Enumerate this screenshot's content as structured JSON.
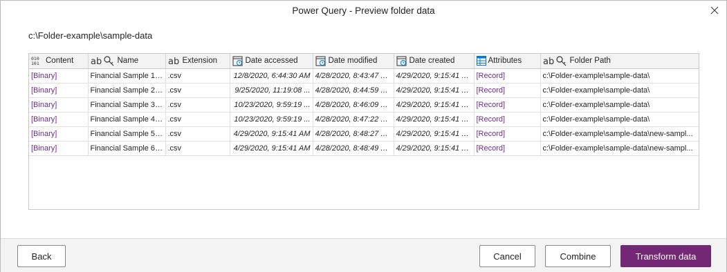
{
  "window": {
    "title": "Power Query - Preview folder data"
  },
  "folder_path": "c:\\Folder-example\\sample-data",
  "table": {
    "columns": [
      {
        "label": "Content",
        "type_icon": "binary-type-icon"
      },
      {
        "label": "Name",
        "type_icon": "text-key-type-icon"
      },
      {
        "label": "Extension",
        "type_icon": "text-type-icon"
      },
      {
        "label": "Date accessed",
        "type_icon": "datetime-type-icon"
      },
      {
        "label": "Date modified",
        "type_icon": "datetime-type-icon"
      },
      {
        "label": "Date created",
        "type_icon": "datetime-type-icon"
      },
      {
        "label": "Attributes",
        "type_icon": "record-type-icon"
      },
      {
        "label": "Folder Path",
        "type_icon": "text-key-type-icon"
      }
    ],
    "rows": [
      [
        "[Binary]",
        "Financial Sample 1....",
        ".csv",
        "12/8/2020, 6:44:30 AM",
        "4/28/2020, 8:43:47 AM",
        "4/29/2020, 9:15:41 A...",
        "[Record]",
        "c:\\Folder-example\\sample-data\\"
      ],
      [
        "[Binary]",
        "Financial Sample 2....",
        ".csv",
        "9/25/2020, 11:19:08 ...",
        "4/28/2020, 8:44:59 AM",
        "4/29/2020, 9:15:41 A...",
        "[Record]",
        "c:\\Folder-example\\sample-data\\"
      ],
      [
        "[Binary]",
        "Financial Sample 3....",
        ".csv",
        "10/23/2020, 9:59:19 ...",
        "4/28/2020, 8:46:09 AM",
        "4/29/2020, 9:15:41 A...",
        "[Record]",
        "c:\\Folder-example\\sample-data\\"
      ],
      [
        "[Binary]",
        "Financial Sample 4....",
        ".csv",
        "10/23/2020, 9:59:19 ...",
        "4/28/2020, 8:47:22 AM",
        "4/29/2020, 9:15:41 A...",
        "[Record]",
        "c:\\Folder-example\\sample-data\\"
      ],
      [
        "[Binary]",
        "Financial Sample 5....",
        ".csv",
        "4/29/2020, 9:15:41 AM",
        "4/28/2020, 8:48:27 AM",
        "4/29/2020, 9:15:41 A...",
        "[Record]",
        "c:\\Folder-example\\sample-data\\new-sampl..."
      ],
      [
        "[Binary]",
        "Financial Sample 6....",
        ".csv",
        "4/29/2020, 9:15:41 AM",
        "4/28/2020, 8:48:49 AM",
        "4/29/2020, 9:15:41 A...",
        "[Record]",
        "c:\\Folder-example\\sample-data\\new-sampl..."
      ]
    ]
  },
  "footer": {
    "back_label": "Back",
    "cancel_label": "Cancel",
    "combine_label": "Combine",
    "transform_label": "Transform data"
  },
  "colors": {
    "accent": "#742774",
    "link": "#6b2c8e"
  }
}
